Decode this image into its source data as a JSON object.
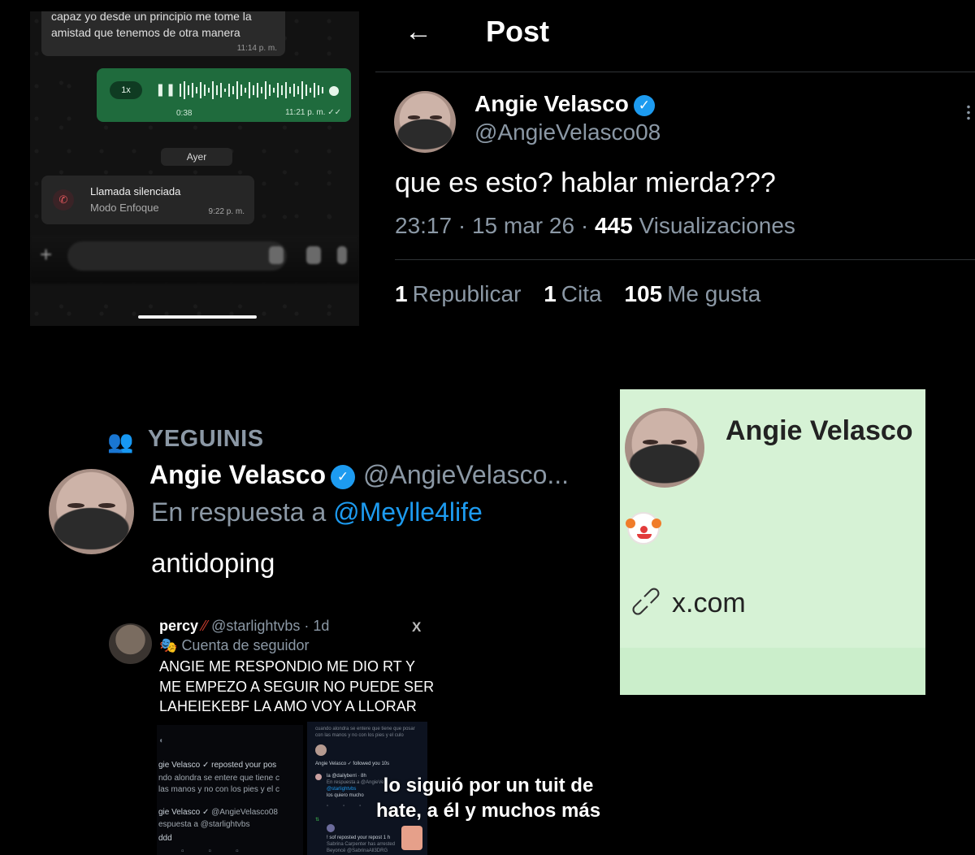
{
  "whatsapp": {
    "message_text": "capaz yo desde un principio me tome la amistad que tenemos de otra manera",
    "message_time": "11:14 p. m.",
    "voice_speed": "1x",
    "voice_duration": "0:38",
    "voice_time": "11:21 p. m. ✓✓",
    "day_separator": "Ayer",
    "call_title": "Llamada silenciada",
    "call_subtitle": "Modo Enfoque",
    "call_time": "9:22 p. m.",
    "colors": {
      "voice_bubble": "#1f6b3d",
      "panel_bg": "#121212"
    }
  },
  "post": {
    "header_title": "Post",
    "author_name": "Angie Velasco",
    "author_handle": "@AngieVelasco08",
    "text": "que es esto? hablar mierda???",
    "time": "23:17",
    "date": "15 mar 26",
    "views_count": "445",
    "views_label": "Visualizaciones",
    "stats": [
      {
        "count": "1",
        "label": "Republicar"
      },
      {
        "count": "1",
        "label": "Cita"
      },
      {
        "count": "105",
        "label": "Me gusta"
      }
    ]
  },
  "reply": {
    "group": "YEGUINIS",
    "author_name": "Angie Velasco",
    "author_handle": "@AngieVelasco...",
    "reply_prefix": "En respuesta a",
    "reply_to": "@Meylle4life",
    "text": "antidoping"
  },
  "profile_card": {
    "name": "Angie Velasco",
    "bio_emoji": "clown-face",
    "link": "x.com",
    "colors": {
      "background": "#d6f2d5"
    }
  },
  "percy_tweet": {
    "name": "percy",
    "handle_meta": "@starlightvbs · 1d",
    "follow_label": "Cuenta de seguidor",
    "text": "ANGIE ME RESPONDIO ME DIO RT Y ME EMPEZO A SEGUIR NO PUEDE SER LAHEIEKEBF LA AMO VOY A LLORAR"
  },
  "embedded_left": {
    "repost_name": "gie Velasco",
    "repost_action": "reposted your pos",
    "repost_line1": "ndo alondra se entere que tiene c",
    "repost_line2": "las manos y no con los pies y el c",
    "reply_name": "gie Velasco",
    "reply_handle": "@AngieVelasco08",
    "reply_prefix": "espuesta a",
    "reply_to": "@starlightvbs",
    "reply_text": "ddd"
  },
  "embedded_right": {
    "top_line1": "cuando alondra se entere que tiene que posar",
    "top_line2": "con las manos y no con los pies y el culo",
    "follow_name": "Angie Velasco",
    "follow_action": "followed you",
    "follow_time": "10s",
    "reply_name": "la",
    "reply_handle": "@dailyberri · 8h",
    "reply_prefix": "En respuesta a",
    "reply_to": "@AngieVe",
    "reply_mention": "@starlightvbs",
    "reply_text": "los quiero mucho",
    "repost_name": "! sof",
    "repost_action": "reposted your repost",
    "repost_time": "1 h",
    "repost_line": "Sabrina Carpenter has arrested",
    "repost_line2": "Beyoncé @SabrinaAll3DRG"
  },
  "caption": "lo siguió por un tuit de hate, a él y muchos más"
}
